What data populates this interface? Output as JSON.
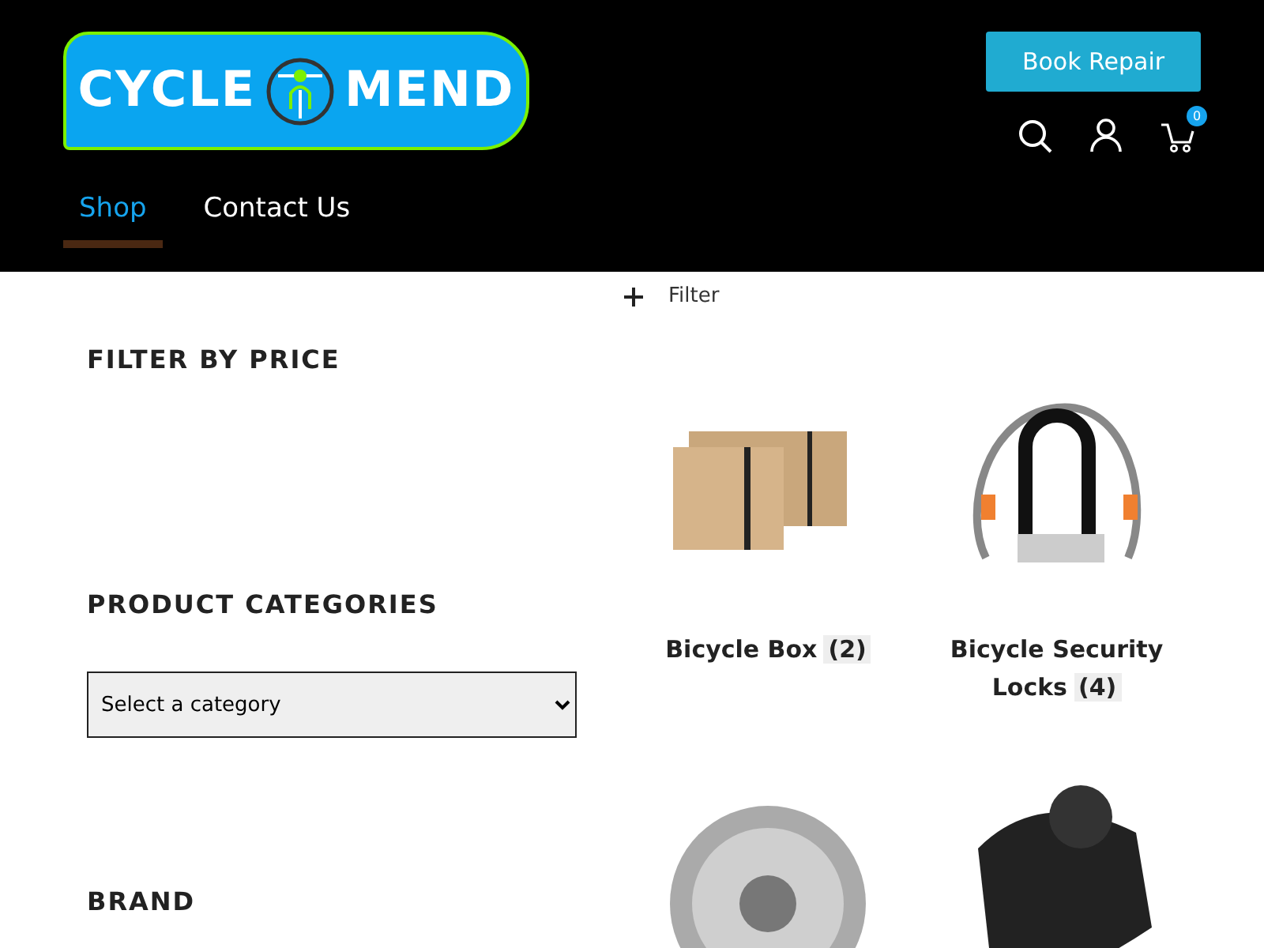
{
  "logo": {
    "word_1": "CYCLE",
    "word_2": "MEND"
  },
  "nav": [
    {
      "label": "Shop",
      "selected": true
    },
    {
      "label": "Contact Us",
      "selected": false
    }
  ],
  "book_button": "Book Repair",
  "cart_count": "0",
  "filter_toggle": "Filter",
  "sidebar": [
    {
      "kind": "heading",
      "title": "FILTER BY PRICE"
    },
    {
      "kind": "heading",
      "title": "PRODUCT CATEGORIES"
    },
    {
      "kind": "select",
      "value": "Select a category"
    },
    {
      "kind": "heading",
      "title": "BRAND"
    }
  ],
  "categories": [
    {
      "name": "Bicycle Box",
      "count": "(2)",
      "kind": "boxes"
    },
    {
      "name": "Bicycle Security Locks",
      "count": "(4)",
      "kind": "lock"
    },
    {
      "kind": "cassette"
    },
    {
      "kind": "shifter"
    }
  ]
}
